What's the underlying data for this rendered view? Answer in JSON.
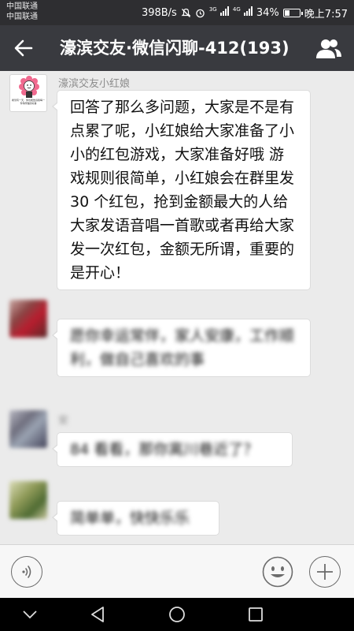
{
  "status_bar": {
    "carrier_1": "中国联通",
    "carrier_2": "中国联通",
    "speed": "398B/s",
    "network_1": "3G",
    "network_2": "4G",
    "battery": "34%",
    "time": "晚上7:57",
    "battery_level": 0.34
  },
  "header": {
    "title": "濠滨交友·微信闪聊-412(193)",
    "back_icon": "back-arrow-icon",
    "group_icon": "group-members-icon"
  },
  "messages": [
    {
      "sender": "濠滨交友小红娘",
      "avatar_text": "希望有一天，你也能告诉我每一件你所做的好事",
      "text": "回答了那么多问题，大家是不是有点累了呢，小红娘给大家准备了小小的红包游戏，大家准备好哦 游戏规则很简单，小红娘会在群里发 30 个红包，抢到金额最大的人给大家发语音唱一首歌或者再给大家发一次红包，金额无所谓，重要的是开心！"
    },
    {
      "sender": "",
      "text": "愿你幸运常伴，家人安康，工作顺利，做自己喜欢的事"
    },
    {
      "sender": "安",
      "text": "84 看看，那你离川巷近了？"
    },
    {
      "sender": "",
      "text": "简单单，快快乐乐"
    }
  ],
  "input_bar": {
    "voice_icon": "voice-input-icon",
    "emoji_icon": "emoji-icon",
    "plus_icon": "plus-icon"
  },
  "nav_bar": {
    "icons": [
      "collapse-icon",
      "back-icon",
      "home-icon",
      "recents-icon"
    ]
  },
  "colors": {
    "title_bar": "#393a3f",
    "status_bar": "#2e2e31",
    "chat_bg": "#ebebeb"
  }
}
